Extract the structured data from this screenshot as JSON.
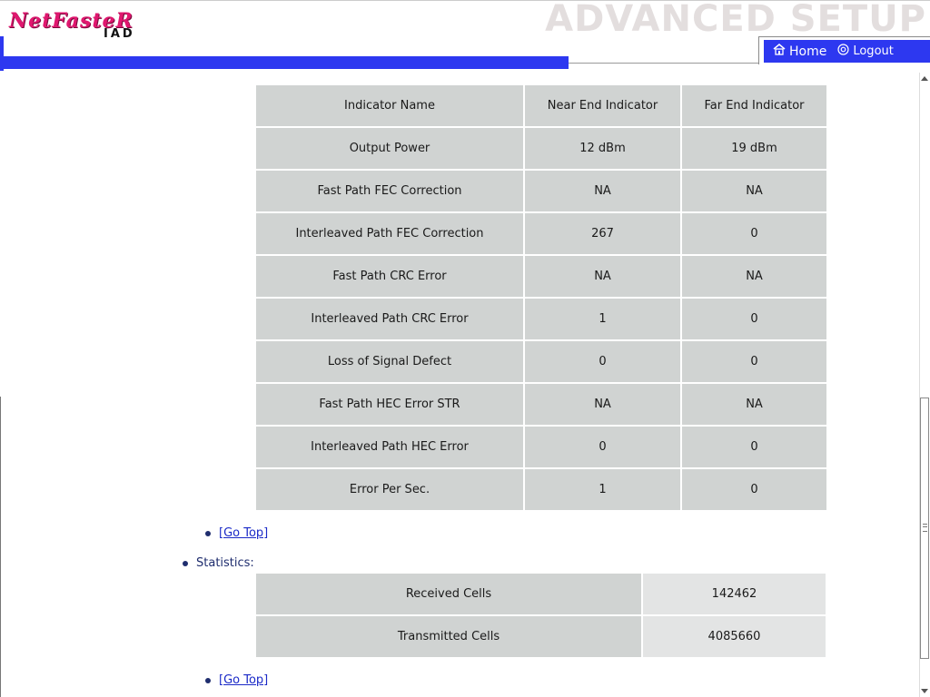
{
  "header": {
    "logo_main": "NetFasteR",
    "logo_sub": "IAD",
    "title": "ADVANCED SETUP",
    "nav": {
      "home_label": "Home",
      "logout_label": "Logout"
    }
  },
  "indicator_table": {
    "headers": [
      "Indicator Name",
      "Near End Indicator",
      "Far End Indicator"
    ],
    "rows": [
      [
        "Output Power",
        "12 dBm",
        "19 dBm"
      ],
      [
        "Fast Path FEC Correction",
        "NA",
        "NA"
      ],
      [
        "Interleaved Path FEC Correction",
        "267",
        "0"
      ],
      [
        "Fast Path CRC Error",
        "NA",
        "NA"
      ],
      [
        "Interleaved Path CRC Error",
        "1",
        "0"
      ],
      [
        "Loss of Signal Defect",
        "0",
        "0"
      ],
      [
        "Fast Path HEC Error STR",
        "NA",
        "NA"
      ],
      [
        "Interleaved Path HEC Error",
        "0",
        "0"
      ],
      [
        "Error Per Sec.",
        "1",
        "0"
      ]
    ]
  },
  "go_top_label": "[Go Top]",
  "statistics": {
    "label": "Statistics:",
    "rows": [
      [
        "Received Cells",
        "142462"
      ],
      [
        "Transmitted Cells",
        "4085660"
      ]
    ]
  },
  "colors": {
    "accent_blue": "#2d38f0",
    "logo_pink": "#e0176f",
    "cell_gray": "#d0d3d2"
  }
}
